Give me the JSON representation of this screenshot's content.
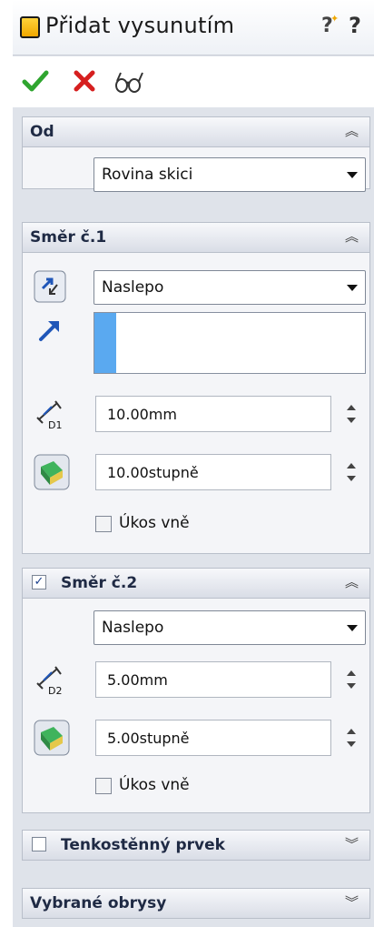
{
  "title": "Přidat vysunutím",
  "actions": {
    "ok": "check-icon",
    "cancel": "x-icon",
    "preview": "glasses-icon"
  },
  "od": {
    "title": "Od",
    "value": "Rovina skici"
  },
  "dir1": {
    "title": "Směr č.1",
    "end_condition": "Naslepo",
    "depth": "10.00mm",
    "depth_icon_label": "D1",
    "draft": "10.00stupně",
    "draft_out": "Úkos vně"
  },
  "dir2": {
    "title": "Směr č.2",
    "enabled_mark": "✓",
    "end_condition": "Naslepo",
    "depth": "5.00mm",
    "depth_icon_label": "D2",
    "draft": "5.00stupně",
    "draft_out": "Úkos vně"
  },
  "thin": {
    "title": "Tenkostěnný prvek"
  },
  "contours": {
    "title": "Vybrané obrysy"
  },
  "colors": {
    "accent_blue": "#5aa9f0",
    "ok_green": "#2fa52f",
    "cancel_red": "#d61f1f",
    "draft_green": "#2f9a4a"
  }
}
